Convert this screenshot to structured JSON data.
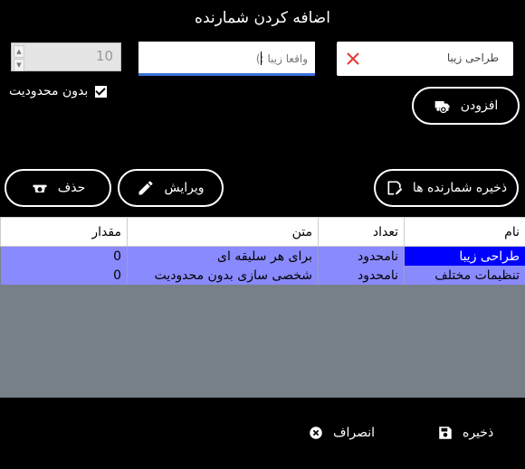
{
  "dialog": {
    "title": "اضافه کردن شمارنده"
  },
  "form": {
    "name_value": "طراحی زیبا",
    "text_placeholder": "واقعا زیبا :)",
    "quantity_value": "10",
    "unlimited_label": "بدون محدودیت",
    "unlimited_checked": true,
    "add_label": "افزودن"
  },
  "toolbar": {
    "save_counters_label": "ذخیره شمارنده ها",
    "edit_label": "ویرایش",
    "delete_label": "حذف"
  },
  "table": {
    "columns": [
      "نام",
      "تعداد",
      "متن",
      "مقدار"
    ],
    "rows": [
      {
        "name": "طراحی زیبا",
        "count": "نامحدود",
        "text": "برای هر سلیقه ای",
        "value": "0"
      },
      {
        "name": "تنظیمات مختلف",
        "count": "نامحدود",
        "text": "شخصی سازی بدون محدودیت",
        "value": "0"
      }
    ]
  },
  "footer": {
    "save_label": "ذخیره",
    "cancel_label": "انصراف"
  },
  "colors": {
    "selected_cell": "#0000ff",
    "row_bg": "#8a8aff",
    "grid_bg": "#778089",
    "focus_border": "#3b6fd8",
    "clear_icon": "#e53935"
  }
}
